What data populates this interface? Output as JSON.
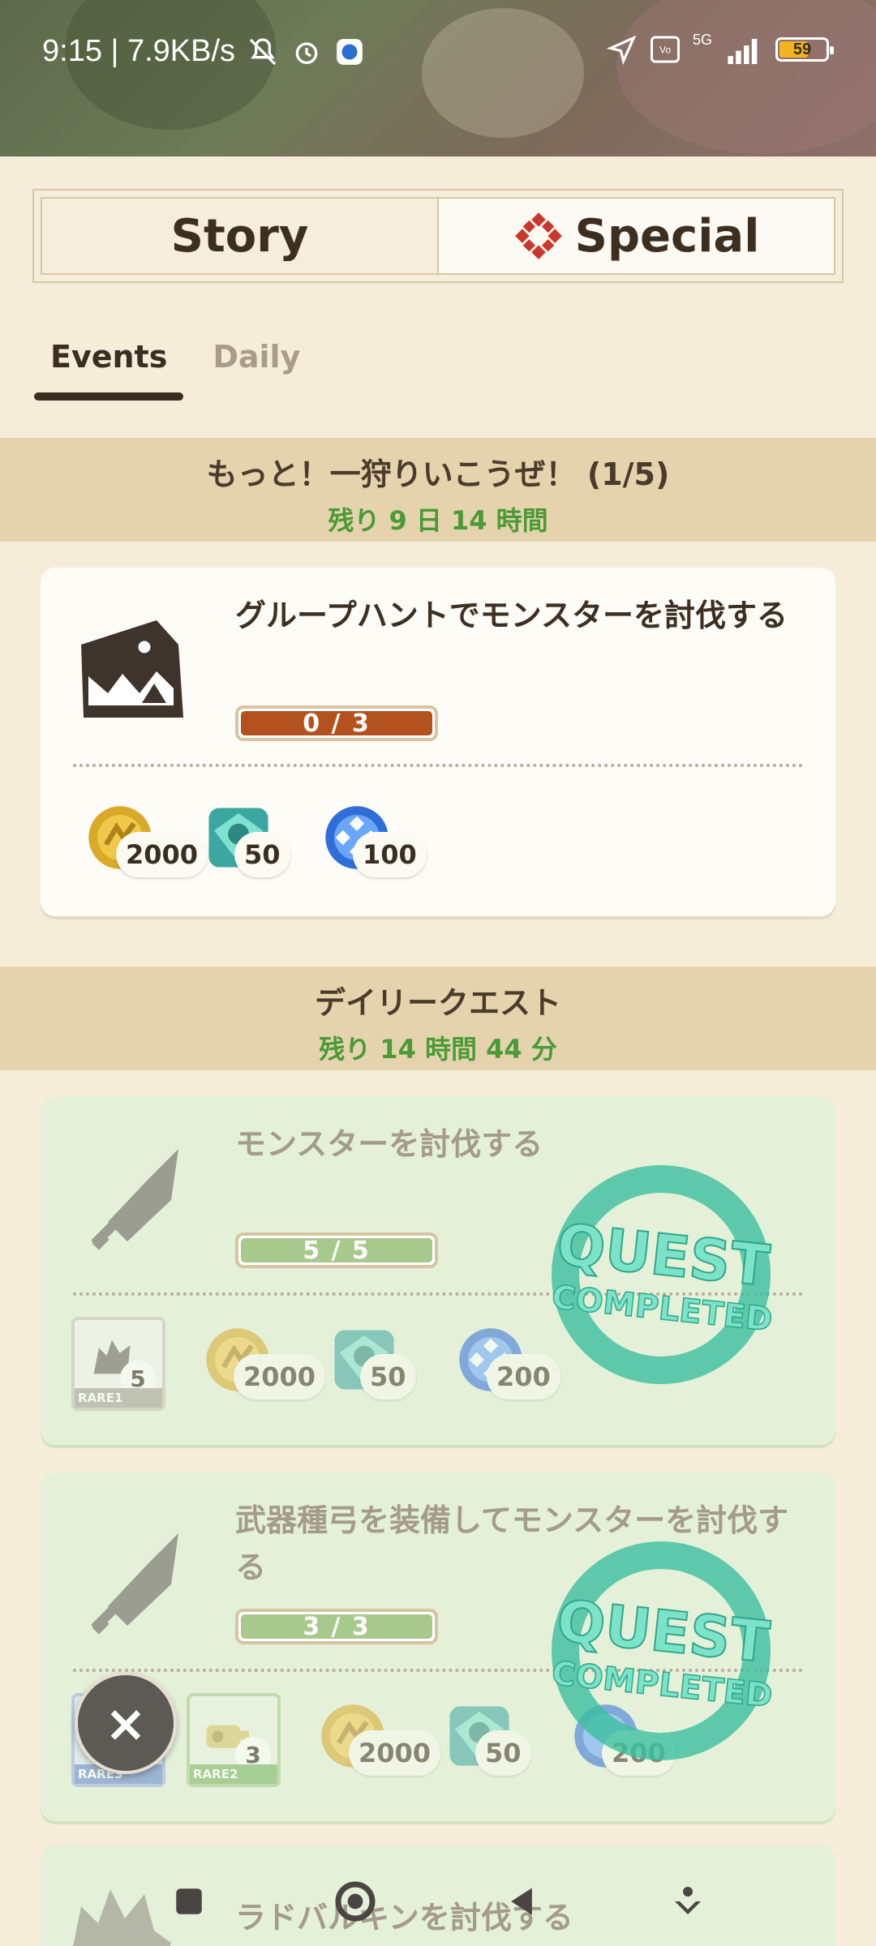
{
  "status_bar": {
    "time_speed": "9:15 | 7.9KB/s",
    "network": "5G",
    "battery": "59"
  },
  "main_tabs": [
    {
      "label": "Story",
      "active": false
    },
    {
      "label": "Special",
      "active": true
    }
  ],
  "sub_tabs": [
    {
      "label": "Events",
      "active": true
    },
    {
      "label": "Daily",
      "active": false
    }
  ],
  "event_section": {
    "title": "もっと！一狩りいこうぜ！ (1/5)",
    "remaining": "残り 9 日 14 時間"
  },
  "event_quest": {
    "title": "グループハントでモンスターを討伐する",
    "progress_text": "0 / 3",
    "progress_fraction": 0.0,
    "rewards": [
      {
        "icon": "gold-coin-icon",
        "count": "2000"
      },
      {
        "icon": "green-gem-icon",
        "count": "50"
      },
      {
        "icon": "blue-orb-icon",
        "count": "100"
      }
    ]
  },
  "daily_section": {
    "title": "デイリークエスト",
    "remaining": "残り 14 時間 44 分"
  },
  "daily_quests": [
    {
      "title": "モンスターを討伐する",
      "progress_text": "5 / 5",
      "progress_fraction": 1.0,
      "stamp": [
        "QUEST",
        "COMPLETED"
      ],
      "rare_items": [
        {
          "label": "RARE1",
          "count": "5",
          "color": "#a7a39b"
        }
      ],
      "rewards": [
        {
          "icon": "gold-coin-icon",
          "count": "2000"
        },
        {
          "icon": "green-gem-icon",
          "count": "50"
        },
        {
          "icon": "blue-orb-icon",
          "count": "200"
        }
      ]
    },
    {
      "title": "武器種弓を装備してモンスターを討伐する",
      "progress_text": "3 / 3",
      "progress_fraction": 1.0,
      "stamp": [
        "QUEST",
        "COMPLETED"
      ],
      "rare_items": [
        {
          "label": "RARE3",
          "count": "1",
          "color": "#6d8fd0"
        },
        {
          "label": "RARE2",
          "count": "3",
          "color": "#7fb86a"
        }
      ],
      "rewards": [
        {
          "icon": "gold-coin-icon",
          "count": "2000"
        },
        {
          "icon": "green-gem-icon",
          "count": "50"
        },
        {
          "icon": "blue-orb-icon",
          "count": "200"
        }
      ]
    },
    {
      "title": "ラドバルキンを討伐する"
    }
  ],
  "close_button": "×"
}
